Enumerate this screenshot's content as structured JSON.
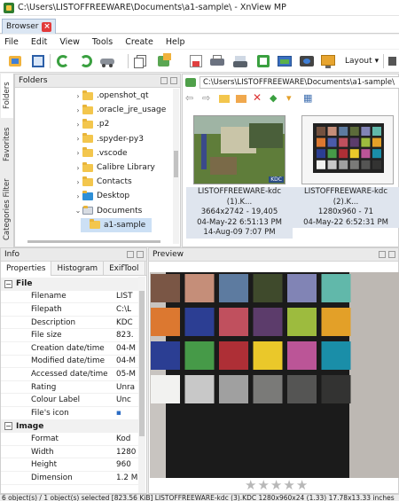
{
  "window": {
    "title": "C:\\Users\\LISTOFFREEWARE\\Documents\\a1-sample\\ - XnView MP"
  },
  "tabs": [
    {
      "label": "Browser"
    }
  ],
  "menu": [
    "File",
    "Edit",
    "View",
    "Tools",
    "Create",
    "Help"
  ],
  "toolbar": {
    "icons": [
      "view-icon",
      "fullscreen-icon",
      "refresh-icon",
      "refresh-alt-icon",
      "car-icon",
      "copy-icon",
      "move-icon",
      "export-icon",
      "print-icon",
      "scan-icon",
      "save-icon",
      "slideshow-icon",
      "settings-icon",
      "wallpaper-icon"
    ],
    "layout_label": "Layout"
  },
  "side_tabs": [
    "Folders",
    "Favorites",
    "Categories Filter"
  ],
  "folders": {
    "title": "Folders",
    "items": [
      {
        "label": ".openshot_qt",
        "expand": "›"
      },
      {
        "label": ".oracle_jre_usage",
        "expand": "›"
      },
      {
        "label": ".p2",
        "expand": "›"
      },
      {
        "label": ".spyder-py3",
        "expand": "›"
      },
      {
        "label": ".vscode",
        "expand": "›"
      },
      {
        "label": "Calibre Library",
        "expand": "›"
      },
      {
        "label": "Contacts",
        "expand": "›"
      },
      {
        "label": "Desktop",
        "expand": "›"
      },
      {
        "label": "Documents",
        "expand": "⌄"
      },
      {
        "label": "a1-sample",
        "expand": ""
      }
    ]
  },
  "browser": {
    "path": "C:\\Users\\LISTOFFREEWARE\\Documents\\a1-sample\\",
    "thumbnails": [
      {
        "name": "LISTOFFREEWARE-kdc (1).K...",
        "size": "3664x2742 - 19,405",
        "date1": "04-May-22 6:51:13 PM",
        "date2": "14-Aug-09 7:07 PM",
        "badge": "KDC"
      },
      {
        "name": "LISTOFFREEWARE-kdc (2).K...",
        "size": "1280x960 - 71",
        "date1": "04-May-22 6:52:31 PM",
        "date2": "",
        "badge": ""
      }
    ]
  },
  "info": {
    "title": "Info",
    "tabs": [
      "Properties",
      "Histogram",
      "ExifTool"
    ],
    "sections": [
      {
        "name": "File",
        "rows": [
          {
            "key": "Filename",
            "value": "LIST"
          },
          {
            "key": "Filepath",
            "value": "C:\\L"
          },
          {
            "key": "Description",
            "value": "KDC"
          },
          {
            "key": "File size",
            "value": "823."
          },
          {
            "key": "Creation date/time",
            "value": "04-M"
          },
          {
            "key": "Modified date/time",
            "value": "04-M"
          },
          {
            "key": "Accessed date/time",
            "value": "05-M"
          },
          {
            "key": "Rating",
            "value": "Unra"
          },
          {
            "key": "Colour Label",
            "value": "Unc"
          },
          {
            "key": "File's icon",
            "value": "▪"
          }
        ]
      },
      {
        "name": "Image",
        "rows": [
          {
            "key": "Format",
            "value": "Kod"
          },
          {
            "key": "Width",
            "value": "1280"
          },
          {
            "key": "Height",
            "value": "960"
          },
          {
            "key": "Dimension",
            "value": "1.2 M"
          }
        ]
      }
    ]
  },
  "preview": {
    "title": "Preview",
    "rating_stars": 0,
    "rating_max": 5
  },
  "status": {
    "text": "6 object(s) / 1 object(s) selected [823.56 KiB]  LISTOFFREEWARE-kdc (3).KDC  1280x960x24 (1.33)  17.78x13.33 inches"
  },
  "colors": {
    "accent": "#3f7fd6",
    "folder": "#f3c64d",
    "tab_close": "#e23a3a",
    "caption_bg": "#dfe5ee"
  }
}
